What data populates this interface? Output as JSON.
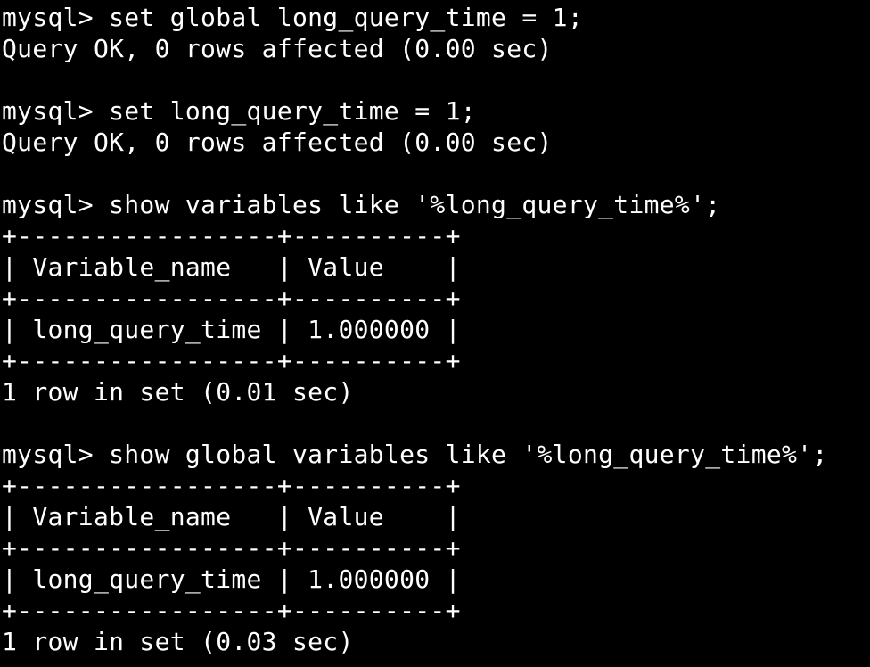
{
  "terminal": {
    "lines": [
      "mysql> set global long_query_time = 1;",
      "Query OK, 0 rows affected (0.00 sec)",
      "",
      "mysql> set long_query_time = 1;",
      "Query OK, 0 rows affected (0.00 sec)",
      "",
      "mysql> show variables like '%long_query_time%';",
      "+-----------------+----------+",
      "| Variable_name   | Value    |",
      "+-----------------+----------+",
      "| long_query_time | 1.000000 |",
      "+-----------------+----------+",
      "1 row in set (0.01 sec)",
      "",
      "mysql> show global variables like '%long_query_time%';",
      "+-----------------+----------+",
      "| Variable_name   | Value    |",
      "+-----------------+----------+",
      "| long_query_time | 1.000000 |",
      "+-----------------+----------+",
      "1 row in set (0.03 sec)"
    ]
  },
  "colors": {
    "background": "#000000",
    "foreground": "#ffffff"
  }
}
